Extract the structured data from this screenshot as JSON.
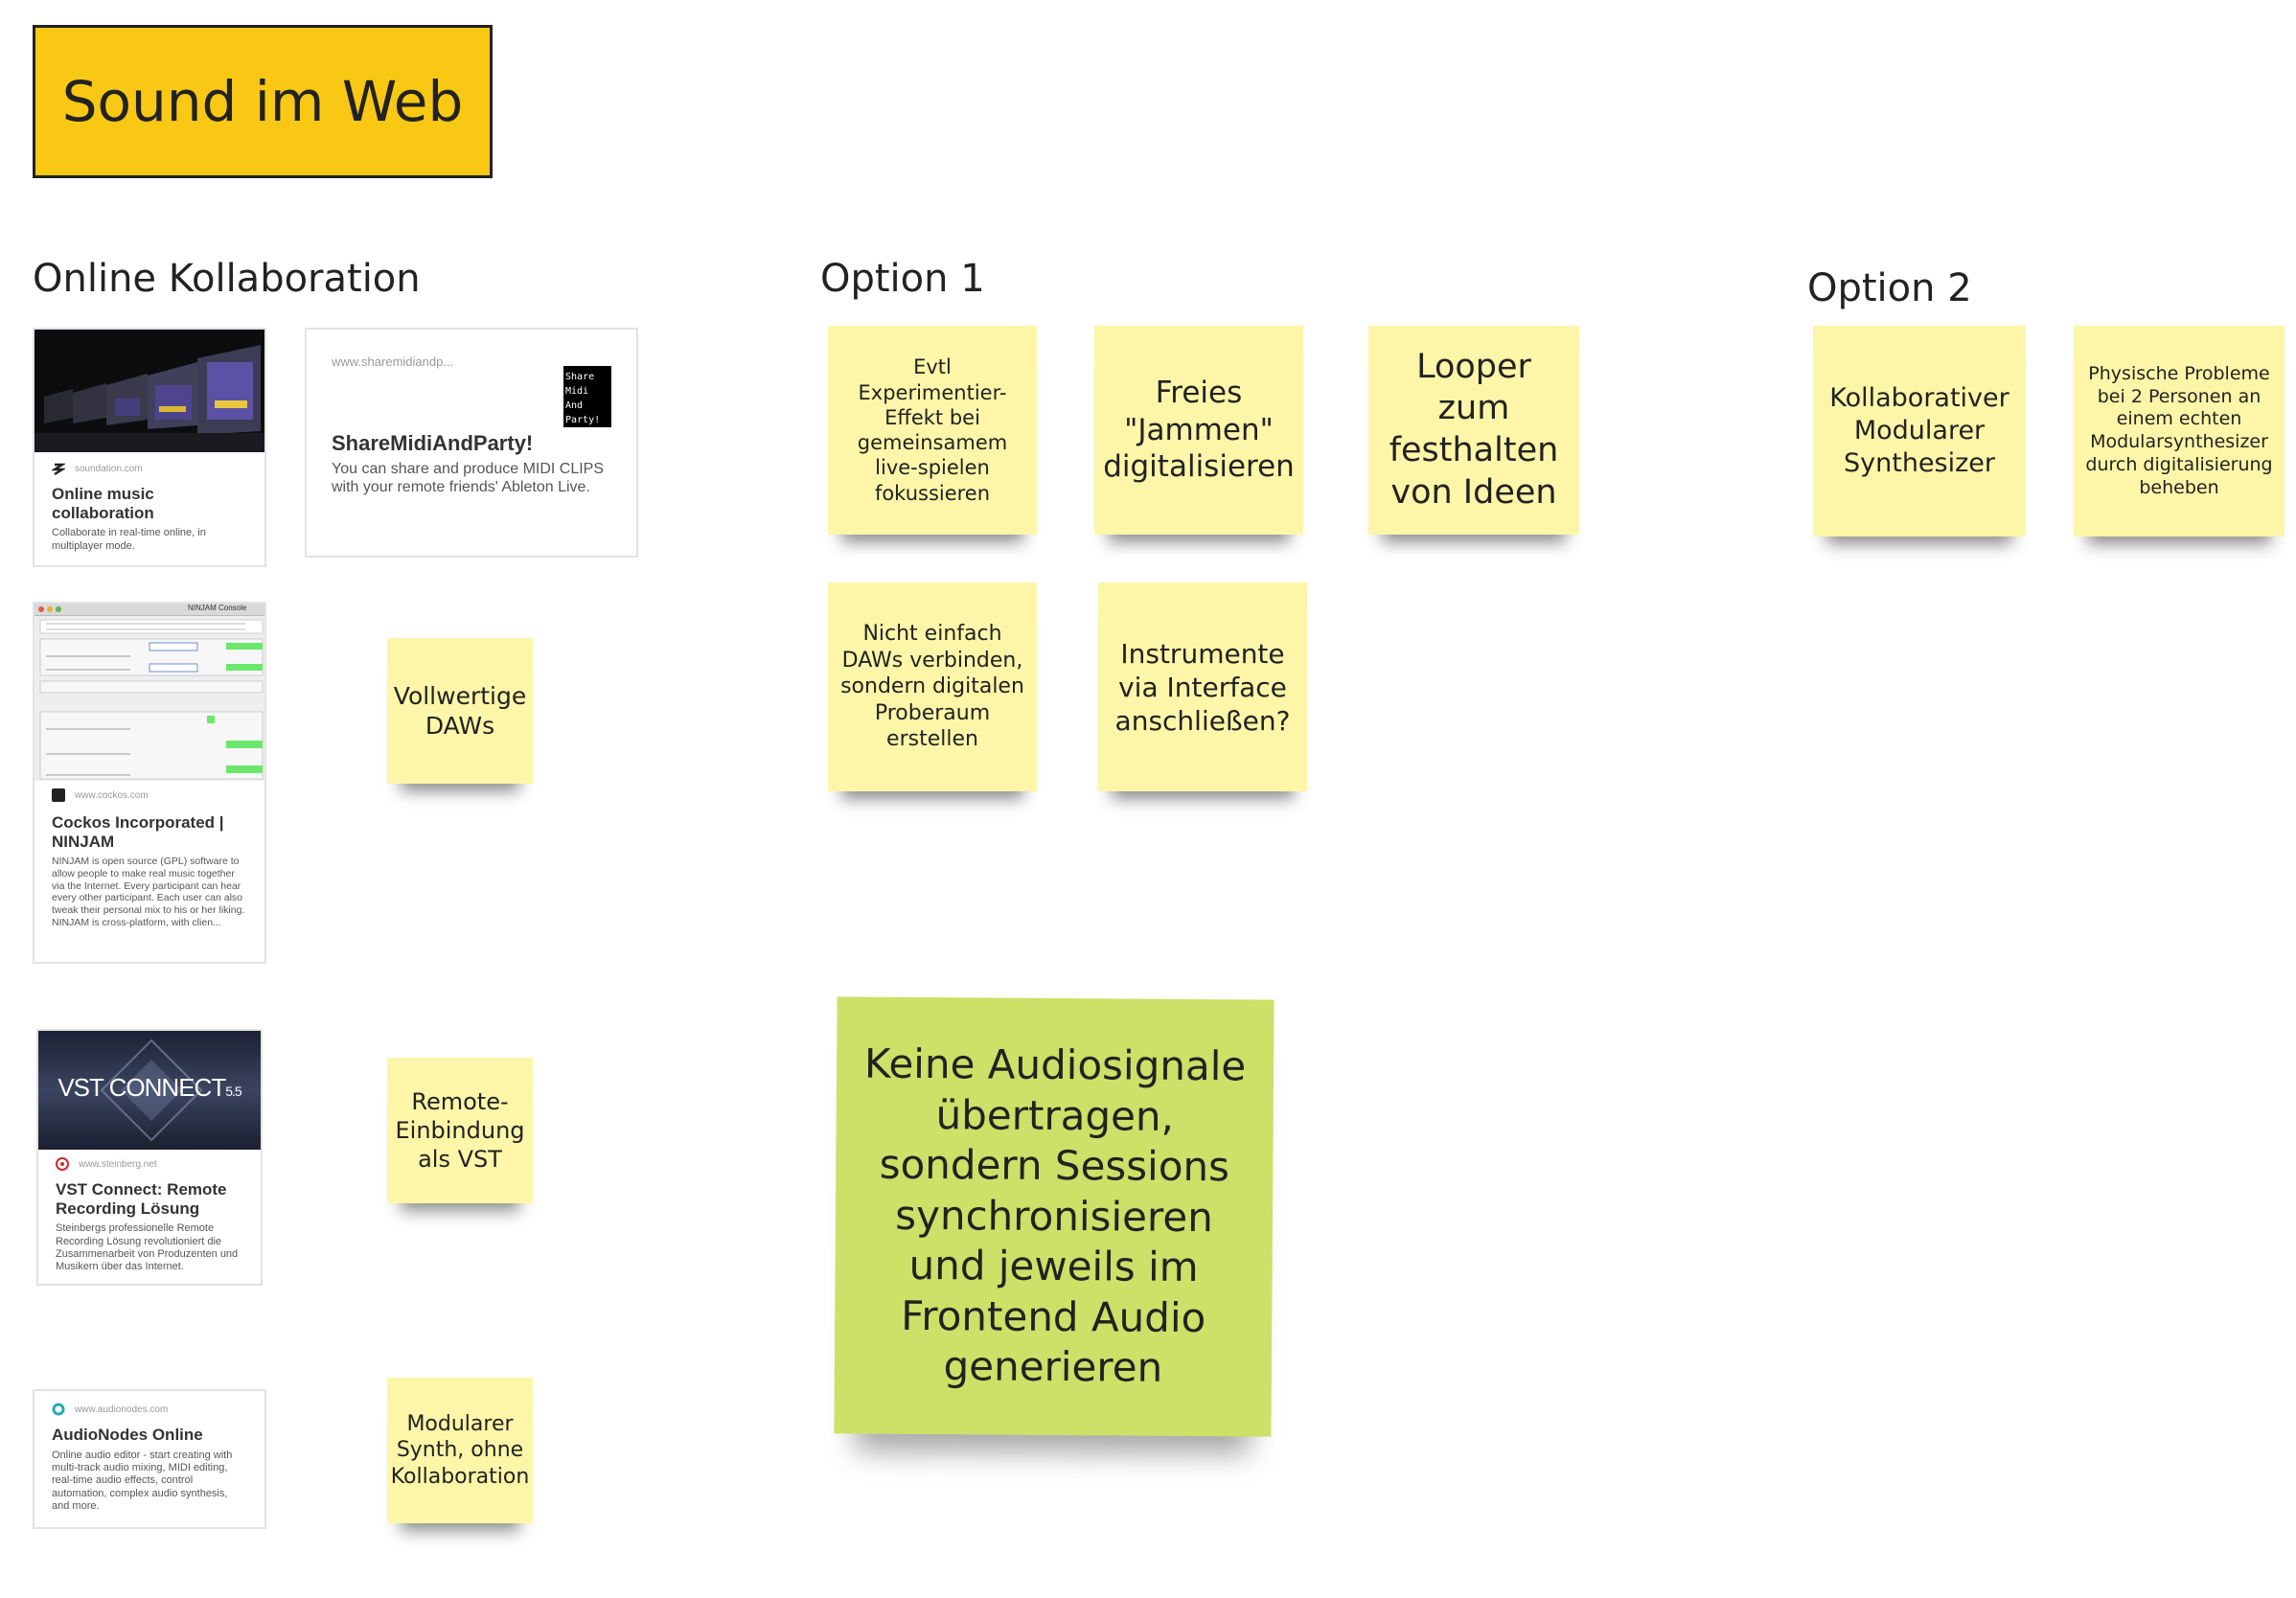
{
  "board": {
    "title": "Sound im Web",
    "headings": {
      "online": "Online Kollaboration",
      "option1": "Option 1",
      "option2": "Option 2"
    }
  },
  "cards": {
    "soundation": {
      "domain": "soundation.com",
      "title": "Online music collaboration",
      "desc": "Collaborate in real-time online, in multiplayer mode."
    },
    "sharemidi": {
      "domain": "www.sharemidiandp...",
      "logo_lines": [
        "Share",
        "Midi",
        "And",
        "Party!"
      ],
      "title": "ShareMidiAndParty!",
      "desc": "You can share and produce MIDI CLIPS with your remote friends' Ableton Live."
    },
    "ninjam": {
      "window_title": "NINJAM Console",
      "domain": "www.cockos.com",
      "title": "Cockos Incorporated | NINJAM",
      "desc": "NINJAM is open source (GPL) software to allow people to make real music together via the Internet. Every participant can hear every other participant. Each user can also tweak their personal mix to his or her liking. NINJAM is cross-platform, with clien..."
    },
    "vst": {
      "image_text": "VST CONNECT",
      "image_version": "5.5",
      "domain": "www.steinberg.net",
      "title": "VST Connect: Remote Recording Lösung",
      "desc": "Steinbergs professionelle Remote Recording Lösung revolutioniert die Zusammenarbeit von Produzenten und Musikern über das Internet."
    },
    "audionodes": {
      "domain": "www.audionodes.com",
      "title": "AudioNodes Online",
      "desc": "Online audio editor - start creating with multi-track audio mixing, MIDI editing, real-time audio effects, control automation, complex audio synthesis, and more."
    }
  },
  "stickies": {
    "vollwertige": "Vollwertige DAWs",
    "remote": "Remote-Einbindung als VST",
    "modular_synth": "Modularer Synth, ohne Kollaboration",
    "evtl": "Evtl Experimentier-Effekt bei gemeinsamem live-spielen fokussieren",
    "freies": "Freies \"Jammen\" digitalisieren",
    "looper": "Looper zum festhalten von Ideen",
    "nicht_einfach": "Nicht einfach DAWs verbinden, sondern digitalen Proberaum erstellen",
    "instrumente": "Instrumente via Interface anschließen?",
    "keine_audio": "Keine Audiosignale übertragen, sondern Sessions synchronisieren und jeweils im Frontend Audio generieren",
    "kollaborativ": "Kollaborativer Modularer Synthesizer",
    "physische": "Physische Probleme bei 2 Personen an einem echten Modularsynthesizer durch digitalisierung beheben"
  },
  "colors": {
    "title_bg": "#f8c814",
    "sticky_yellow": "#fdf6a8",
    "sticky_green": "#cde067"
  }
}
